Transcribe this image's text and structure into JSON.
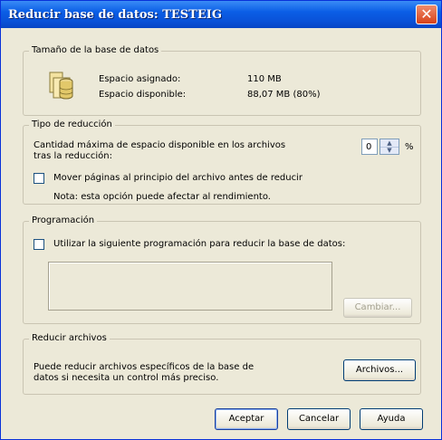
{
  "window": {
    "title": "Reducir base de datos: TESTEIG",
    "close_glyph": "✕"
  },
  "db_size": {
    "legend": "Tamaño de la base de datos",
    "icon": "database-icon",
    "allocated_label": "Espacio asignado:",
    "allocated_value": "110 MB",
    "free_label": "Espacio disponible:",
    "free_value": "88,07 MB (80%)"
  },
  "reduction": {
    "legend": "Tipo de reducción",
    "max_space_line1": "Cantidad máxima de espacio disponible en los archivos",
    "max_space_line2": "tras la reducción:",
    "max_space_value": "0",
    "percent_symbol": "%",
    "move_pages_label": "Mover páginas al principio del archivo antes de reducir",
    "move_pages_checked": false,
    "note": "Nota: esta opción puede afectar al rendimiento."
  },
  "schedule": {
    "legend": "Programación",
    "use_schedule_label": "Utilizar la siguiente programación para reducir la base de datos:",
    "use_schedule_checked": false,
    "change_button": "Cambiar..."
  },
  "files": {
    "legend": "Reducir archivos",
    "description_line1": "Puede reducir archivos específicos de la base de",
    "description_line2": "datos si necesita un control más preciso.",
    "files_button": "Archivos..."
  },
  "footer": {
    "ok_button": "Aceptar",
    "cancel_button": "Cancelar",
    "help_button": "Ayuda"
  }
}
